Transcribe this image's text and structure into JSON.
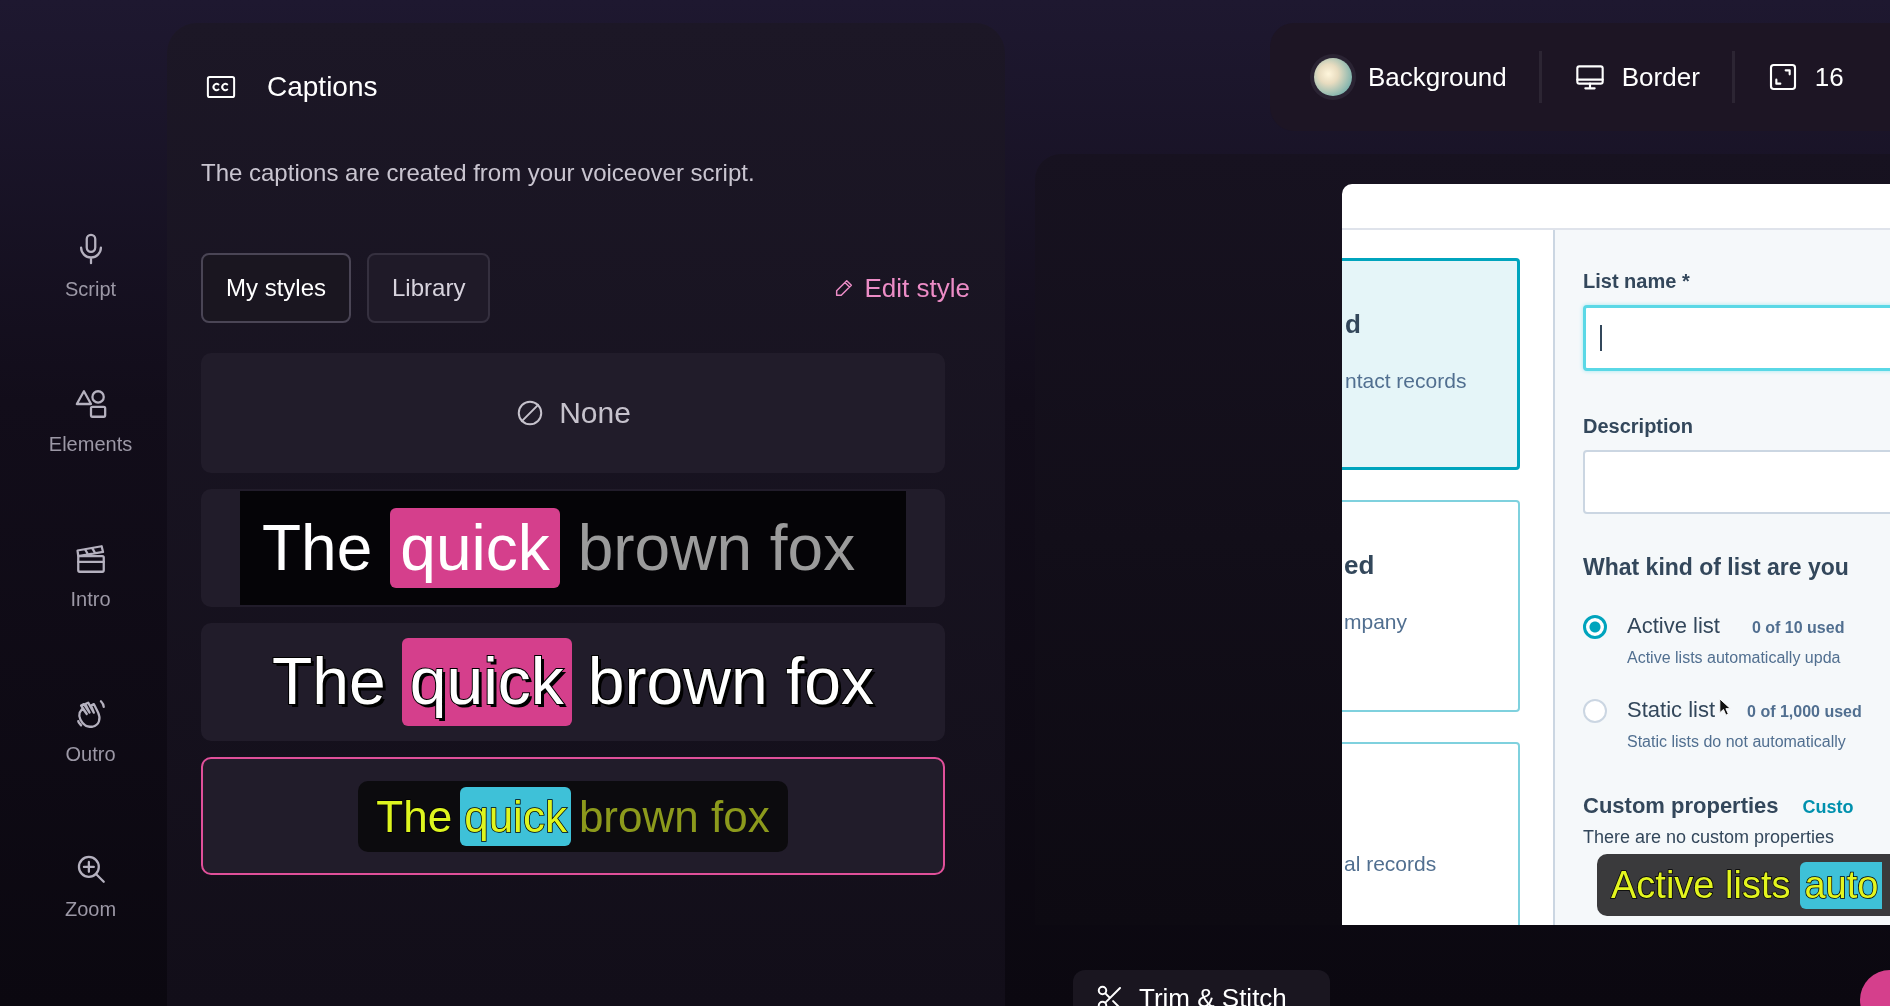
{
  "nav": [
    {
      "label": "Script"
    },
    {
      "label": "Elements"
    },
    {
      "label": "Intro"
    },
    {
      "label": "Outro"
    },
    {
      "label": "Zoom"
    }
  ],
  "captions_panel": {
    "title": "Captions",
    "description": "The captions are created from your voiceover script.",
    "tabs": [
      {
        "label": "My styles",
        "selected": true
      },
      {
        "label": "Library",
        "selected": false
      }
    ],
    "edit_link": "Edit style",
    "styles": [
      {
        "kind": "none",
        "label": "None",
        "selected": false
      },
      {
        "kind": "boxed",
        "selected": false,
        "words": [
          {
            "text": "The",
            "highlighted": false
          },
          {
            "text": "quick",
            "highlighted": true
          },
          {
            "text": "brown fox",
            "highlighted": false
          }
        ]
      },
      {
        "kind": "outline",
        "selected": false,
        "words": [
          {
            "text": "The",
            "highlighted": false
          },
          {
            "text": "quick",
            "highlighted": true
          },
          {
            "text": "brown fox",
            "highlighted": false
          }
        ]
      },
      {
        "kind": "karaoke",
        "selected": true,
        "words": [
          {
            "text": "The",
            "highlighted": false
          },
          {
            "text": "quick",
            "highlighted": true
          },
          {
            "text": "brown fox",
            "highlighted": false
          }
        ]
      }
    ]
  },
  "toolbar": {
    "items": [
      {
        "kind": "swatch",
        "label": "Background"
      },
      {
        "kind": "monitor",
        "label": "Border"
      },
      {
        "kind": "aspect",
        "label": "16"
      }
    ]
  },
  "preview": {
    "list_types": [
      {
        "title": "d",
        "description": "ntact records",
        "selected": true
      },
      {
        "title": "ed",
        "description": "mpany",
        "selected": false
      },
      {
        "description": "al records",
        "selected": false
      }
    ],
    "form": {
      "name_label": "List name *",
      "description_label": "Description",
      "kind_question": "What kind of list are you",
      "list_options": [
        {
          "label": "Active list",
          "usage": "0 of 10 used",
          "hint": "Active lists automatically upda",
          "selected": true
        },
        {
          "label": "Static list",
          "usage": "0 of 1,000 used",
          "hint": "Static lists do not automatically",
          "selected": false
        }
      ],
      "custom_heading": "Custom properties",
      "custom_link": "Custo",
      "custom_note": "There are no custom properties"
    },
    "caption_overlay": {
      "words": [
        {
          "text": "Active lists",
          "highlighted": false
        },
        {
          "text": "auto",
          "highlighted": true
        }
      ]
    }
  },
  "trim_button": "Trim & Stitch"
}
